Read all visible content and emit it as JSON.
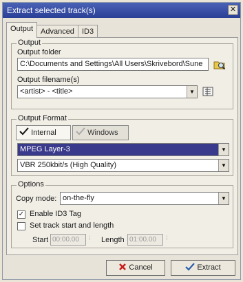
{
  "window": {
    "title": "Extract selected track(s)",
    "close_glyph": "✕"
  },
  "tabs": [
    {
      "label": "Output",
      "active": true
    },
    {
      "label": "Advanced",
      "active": false
    },
    {
      "label": "ID3",
      "active": false
    }
  ],
  "output": {
    "legend": "Output",
    "folder_label": "Output folder",
    "folder_value": "C:\\Documents and Settings\\All Users\\Skrivebord\\Sune",
    "filename_label": "Output filename(s)",
    "filename_value": "<artist> - <title>",
    "browse_icon": "folder-search-icon",
    "tags_icon": "tag-list-icon"
  },
  "format": {
    "legend": "Output Format",
    "internal_label": "Internal",
    "windows_label": "Windows",
    "codec_value": "MPEG Layer-3",
    "quality_value": "VBR 250kbit/s (High Quality)"
  },
  "options": {
    "legend": "Options",
    "copy_mode_label": "Copy mode:",
    "copy_mode_value": "on-the-fly",
    "enable_id3_label": "Enable ID3 Tag",
    "enable_id3_checked": true,
    "set_track_label": "Set track start and length",
    "set_track_checked": false,
    "start_label": "Start",
    "start_value": "00:00.00",
    "length_label": "Length",
    "length_value": "01:00.00"
  },
  "buttons": {
    "cancel": "Cancel",
    "extract": "Extract"
  },
  "colors": {
    "titlebar": "#2a3f96",
    "selected": "#3a3a8c"
  }
}
